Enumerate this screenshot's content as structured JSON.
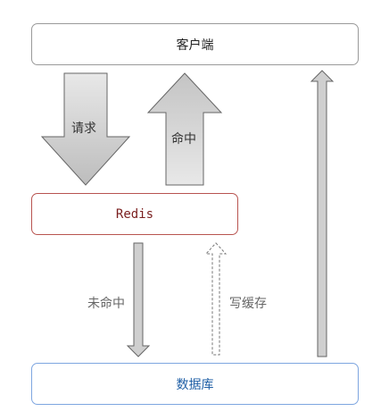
{
  "nodes": {
    "client": "客户端",
    "redis": "Redis",
    "database": "数据库"
  },
  "edges": {
    "request": "请求",
    "hit": "命中",
    "miss": "未命中",
    "write_cache": "写缓存"
  },
  "colors": {
    "arrow_fill": "#d3d3d3",
    "arrow_stroke": "#666666",
    "redis_border": "#b85450",
    "database_border": "#7ea6e0",
    "client_border": "#9a9a9a"
  }
}
